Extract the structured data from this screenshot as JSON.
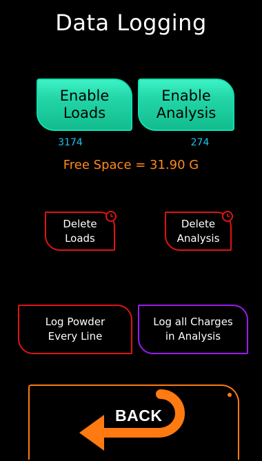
{
  "title": "Data Logging",
  "enable_loads": {
    "line1": "Enable",
    "line2": "Loads",
    "count": "3174"
  },
  "enable_analysis": {
    "line1": "Enable",
    "line2": "Analysis",
    "count": "274"
  },
  "free_space": "Free Space = 31.90 G",
  "delete_loads": {
    "line1": "Delete",
    "line2": "Loads",
    "icon": "clock-icon"
  },
  "delete_analysis": {
    "line1": "Delete",
    "line2": "Analysis",
    "icon": "clock-icon"
  },
  "log_powder": {
    "line1": "Log Powder",
    "line2": "Every Line"
  },
  "log_charges": {
    "line1": "Log all Charges",
    "line2": "in Analysis"
  },
  "back": {
    "label": "BACK",
    "icon": "back-arrow-icon"
  },
  "colors": {
    "background": "#000000",
    "enable_green": "#23d7a8",
    "count_cyan": "#19c6f2",
    "free_space_orange": "#ff8a1c",
    "delete_red": "#e11414",
    "log_powder_red": "#e11414",
    "log_charges_purple": "#9a1cf0",
    "back_orange": "#ff7a10"
  }
}
